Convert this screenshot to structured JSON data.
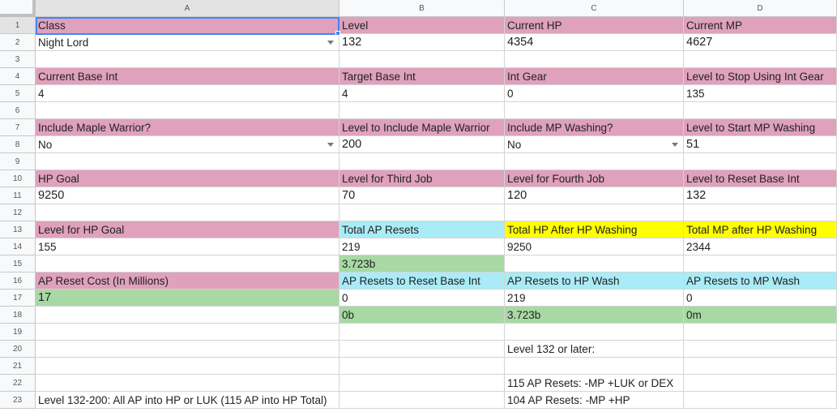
{
  "columns": [
    "A",
    "B",
    "C",
    "D"
  ],
  "rows": [
    "1",
    "2",
    "3",
    "4",
    "5",
    "6",
    "7",
    "8",
    "9",
    "10",
    "11",
    "12",
    "13",
    "14",
    "15",
    "16",
    "17",
    "18",
    "19",
    "20",
    "21",
    "22",
    "23"
  ],
  "r1": {
    "a": "Class",
    "b": "Level",
    "c": "Current HP",
    "d": "Current MP"
  },
  "r2": {
    "a": "Night Lord",
    "b": "132",
    "c": "4354",
    "d": "4627"
  },
  "r4": {
    "a": "Current Base Int",
    "b": "Target Base Int",
    "c": "Int Gear",
    "d": "Level to Stop Using Int Gear"
  },
  "r5": {
    "a": "4",
    "b": "4",
    "c": "0",
    "d": "135"
  },
  "r7": {
    "a": "Include Maple Warrior?",
    "b": "Level to Include Maple Warrior",
    "c": "Include MP Washing?",
    "d": "Level to Start MP Washing"
  },
  "r8": {
    "a": "No",
    "b": "200",
    "c": "No",
    "d": "51"
  },
  "r10": {
    "a": "HP Goal",
    "b": "Level for Third Job",
    "c": "Level for Fourth Job",
    "d": "Level to Reset Base Int"
  },
  "r11": {
    "a": "9250",
    "b": "70",
    "c": "120",
    "d": "132"
  },
  "r13": {
    "a": "Level for HP Goal",
    "b": "Total AP Resets",
    "c": "Total HP After HP Washing",
    "d": "Total MP after HP Washing"
  },
  "r14": {
    "a": "155",
    "b": "219",
    "c": "9250",
    "d": "2344"
  },
  "r15": {
    "b": "3.723b"
  },
  "r16": {
    "a": "AP Reset Cost (In Millions)",
    "b": "AP Resets to Reset Base Int",
    "c": "AP Resets to HP Wash",
    "d": "AP Resets to MP Wash"
  },
  "r17": {
    "a": "17",
    "b": "0",
    "c": "219",
    "d": "0"
  },
  "r18": {
    "b": "0b",
    "c": "3.723b",
    "d": "0m"
  },
  "r20": {
    "c": "Level 132 or later:"
  },
  "r22": {
    "c": "115 AP Resets: -MP +LUK or DEX"
  },
  "r23": {
    "a": "Level 132-200: All AP into HP or LUK (115 AP into HP Total)",
    "c": "104 AP Resets: -MP +HP"
  },
  "colors": {
    "header_pink": "#dfa1bc",
    "output_cyan": "#a9ecf7",
    "highlight_yellow": "#ffff00",
    "cost_green": "#a8d9a4",
    "selection_blue": "#4285f4"
  }
}
